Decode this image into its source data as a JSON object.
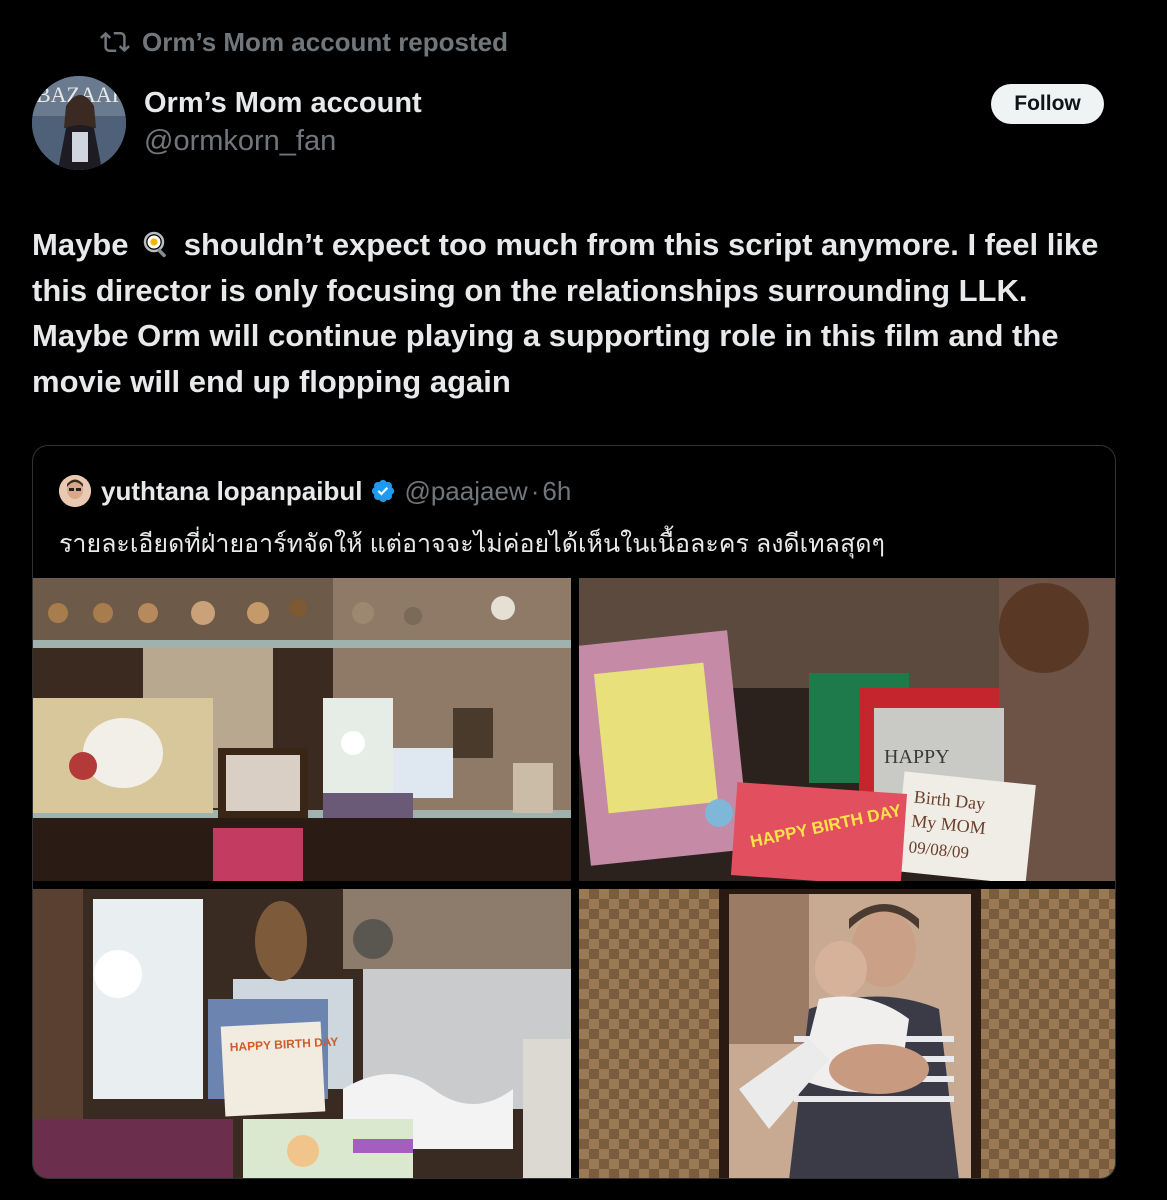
{
  "repost": {
    "label": "Orm’s Mom account reposted",
    "icon": "repost-icon"
  },
  "author": {
    "name": "Orm’s Mom account",
    "handle": "@ormkorn_fan",
    "avatar_icon": "profile-avatar",
    "avatar_text": "BAZAAR"
  },
  "follow_label": "Follow",
  "post": {
    "text_before_emoji": "Maybe",
    "emoji": "fried-egg-emoji",
    "text_after_emoji": "shouldn’t expect too much from this script anymore. I feel like this director is only focusing on the relationships surrounding LLK. Maybe Orm will continue playing a supporting role in this film and the movie will end up flopping again"
  },
  "quote": {
    "name": "yuthtana lopanpaibul",
    "verified_icon": "verified-badge-icon",
    "handle": "@paajaew",
    "separator": "·",
    "time": "6h",
    "text": "รายละเอียดที่ฝ่ายอาร์ทจัดให้ แต่อาจจะไม่ค่อยได้เห็นในเนื้อละคร ลงดีเทลสุดๆ",
    "media": [
      {
        "name": "photo-display-cabinet"
      },
      {
        "name": "photo-birthday-cards",
        "texts": [
          "HAPPY",
          "Birth Day",
          "My MOM",
          "09/08/09",
          "HAPPY BIRTH DAY"
        ]
      },
      {
        "name": "photo-birthday-card-shelf",
        "texts": [
          "HAPPY BIRTH DAY"
        ]
      },
      {
        "name": "photo-framed-mother-baby"
      }
    ]
  }
}
